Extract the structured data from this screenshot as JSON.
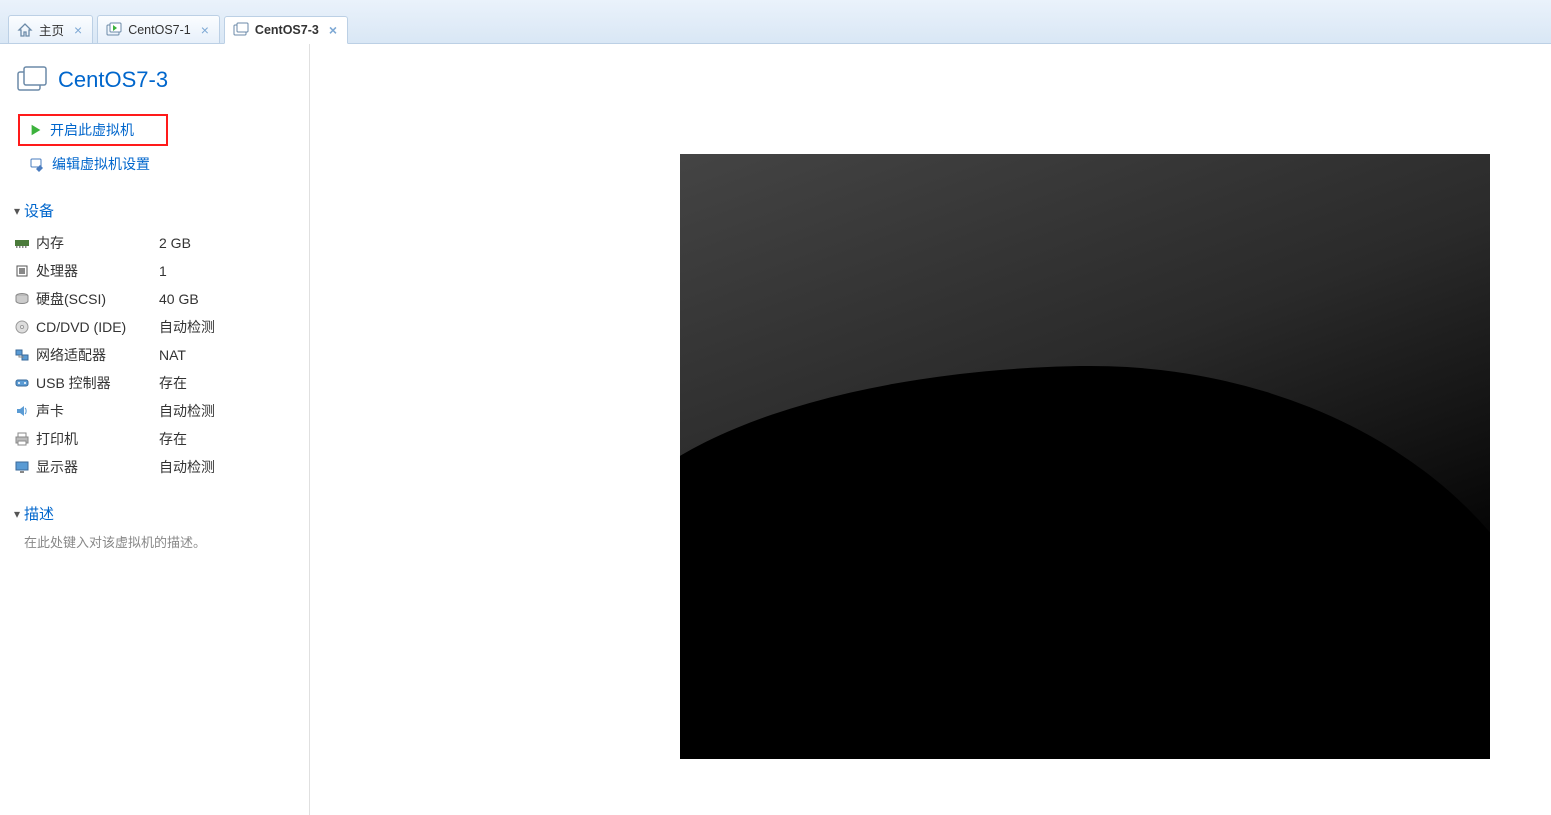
{
  "tabs": [
    {
      "label": "主页",
      "active": false,
      "closeable": true,
      "icon": "home"
    },
    {
      "label": "CentOS7-1",
      "active": false,
      "closeable": true,
      "icon": "vm"
    },
    {
      "label": "CentOS7-3",
      "active": true,
      "closeable": true,
      "icon": "vm"
    }
  ],
  "vm": {
    "title": "CentOS7-3"
  },
  "actions": {
    "power_on": "开启此虚拟机",
    "edit_settings": "编辑虚拟机设置"
  },
  "sections": {
    "devices": "设备",
    "description": "描述"
  },
  "devices": [
    {
      "icon": "memory",
      "label": "内存",
      "value": "2 GB"
    },
    {
      "icon": "cpu",
      "label": "处理器",
      "value": "1"
    },
    {
      "icon": "disk",
      "label": "硬盘(SCSI)",
      "value": "40 GB"
    },
    {
      "icon": "disc",
      "label": "CD/DVD (IDE)",
      "value": "自动检测"
    },
    {
      "icon": "network",
      "label": "网络适配器",
      "value": "NAT"
    },
    {
      "icon": "usb",
      "label": "USB 控制器",
      "value": "存在"
    },
    {
      "icon": "sound",
      "label": "声卡",
      "value": "自动检测"
    },
    {
      "icon": "printer",
      "label": "打印机",
      "value": "存在"
    },
    {
      "icon": "display",
      "label": "显示器",
      "value": "自动检测"
    }
  ],
  "description_placeholder": "在此处键入对该虚拟机的描述。"
}
